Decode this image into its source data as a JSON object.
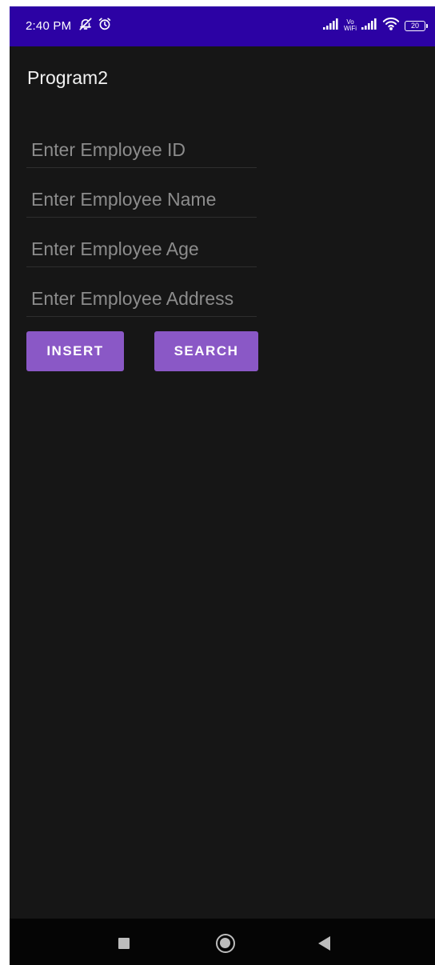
{
  "status_bar": {
    "time": "2:40 PM",
    "vowifi_top": "Vo",
    "vowifi_bottom": "WiFi",
    "battery": "20",
    "background_color": "#2c02a4",
    "left_icons": [
      "bell-off-icon",
      "alarm-icon"
    ],
    "right_icons": [
      "signal-icon",
      "vowifi-icon",
      "signal-icon",
      "wifi-icon",
      "battery-icon"
    ]
  },
  "app": {
    "title": "Program2"
  },
  "form": {
    "employee_id": {
      "value": "",
      "placeholder": "Enter Employee ID"
    },
    "employee_name": {
      "value": "",
      "placeholder": "Enter Employee Name"
    },
    "employee_age": {
      "value": "",
      "placeholder": "Enter Employee Age"
    },
    "employee_address": {
      "value": "",
      "placeholder": "Enter Employee Address"
    }
  },
  "buttons": {
    "insert": "INSERT",
    "search": "SEARCH",
    "color": "#8a58c6"
  },
  "nav_bar": {
    "icons": [
      "recents-icon",
      "home-icon",
      "back-icon"
    ]
  }
}
